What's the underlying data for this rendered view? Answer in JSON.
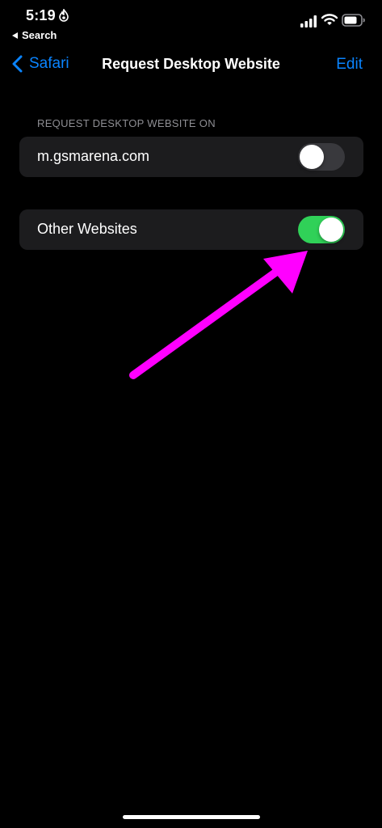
{
  "status_bar": {
    "time": "5:19",
    "back_label": "Search"
  },
  "nav": {
    "back_label": "Safari",
    "title": "Request Desktop Website",
    "edit_label": "Edit"
  },
  "section": {
    "header": "REQUEST DESKTOP WEBSITE ON",
    "items": [
      {
        "label": "m.gsmarena.com",
        "enabled": false
      },
      {
        "label": "Other Websites",
        "enabled": true
      }
    ]
  },
  "colors": {
    "accent": "#0a84ff",
    "toggle_on": "#30d158",
    "toggle_off": "#39393d",
    "cell_bg": "#1c1c1e",
    "annotation": "#ff00ff"
  },
  "icons": {
    "hotspot": "hotspot-icon",
    "signal": "cellular-signal-icon",
    "wifi": "wifi-icon",
    "battery": "battery-icon",
    "back": "chevron-left-icon"
  }
}
